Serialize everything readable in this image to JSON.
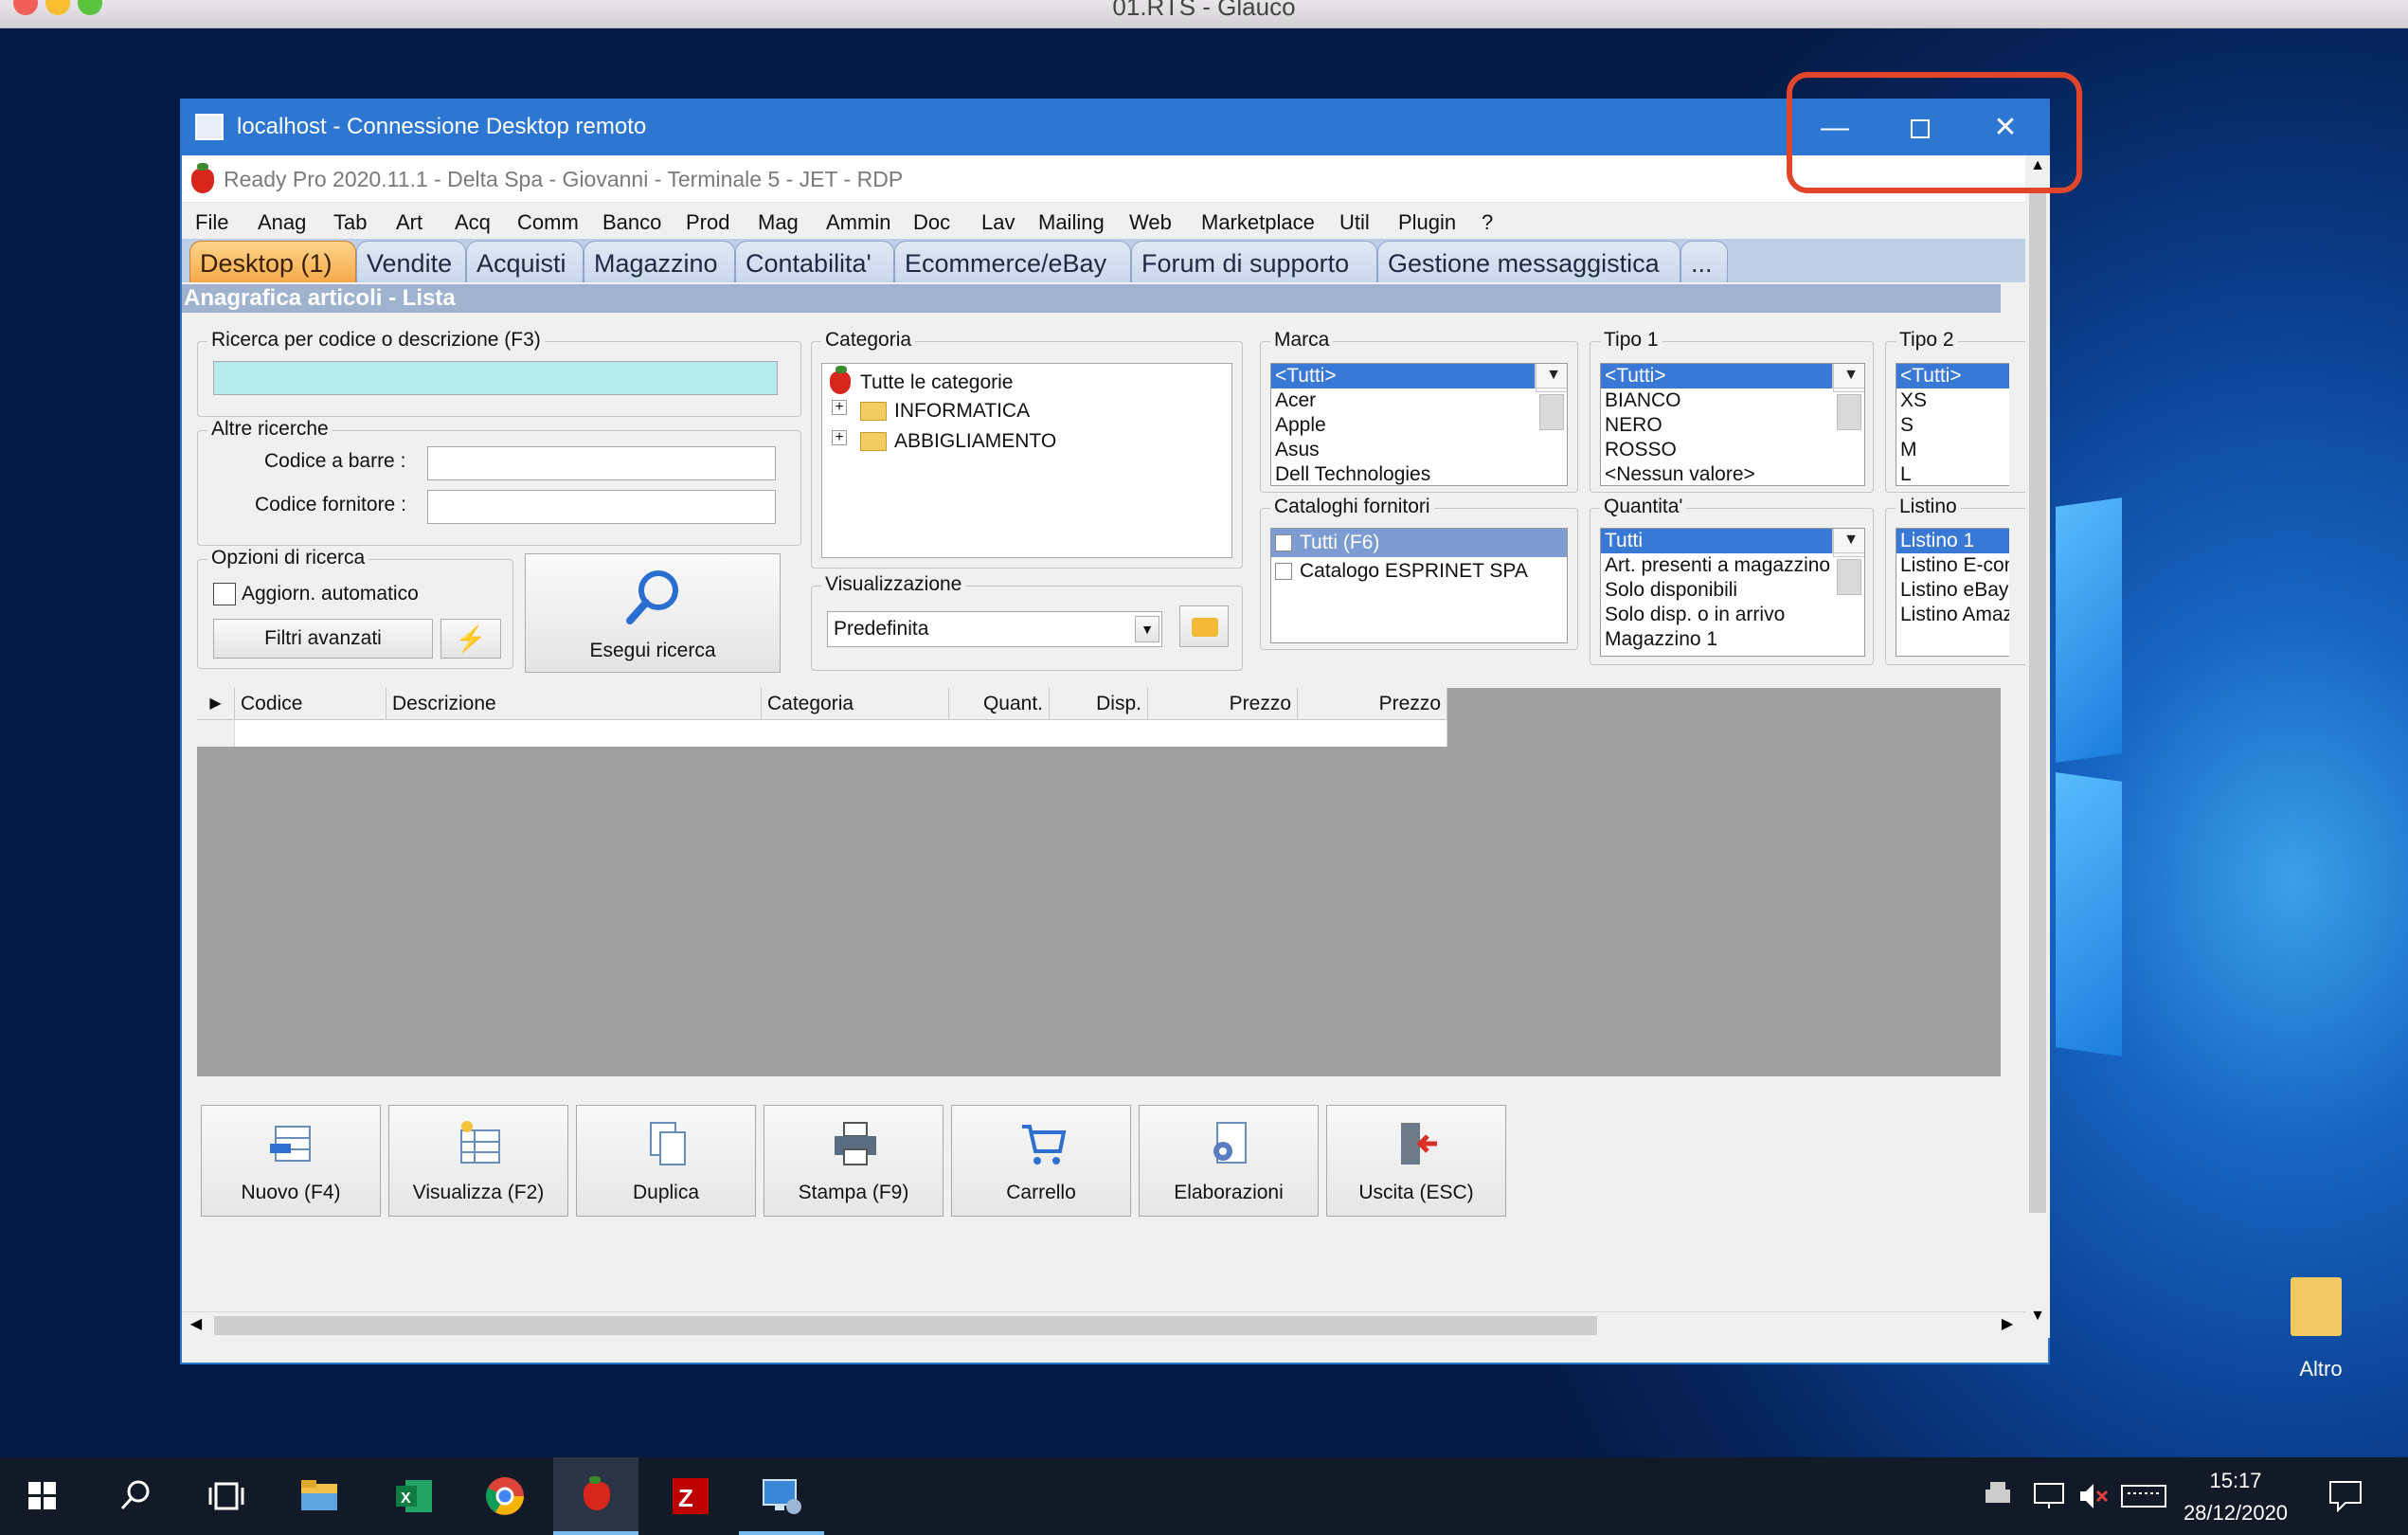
{
  "mac": {
    "title": "01.RTS - Glauco"
  },
  "rdp": {
    "title": "localhost - Connessione Desktop remoto"
  },
  "app": {
    "title": "Ready Pro 2020.11.1 - Delta Spa - Giovanni - Terminale 5 - JET - RDP",
    "menu": [
      "File",
      "Anag",
      "Tab",
      "Art",
      "Acq",
      "Comm",
      "Banco",
      "Prod",
      "Mag",
      "Ammin",
      "Doc",
      "Lav",
      "Mailing",
      "Web",
      "Marketplace",
      "Util",
      "Plugin",
      "?"
    ],
    "tabs": [
      "Desktop (1)",
      "Vendite",
      "Acquisti",
      "Magazzino",
      "Contabilita'",
      "Ecommerce/eBay",
      "Forum di supporto",
      "Gestione messaggistica",
      "..."
    ],
    "section_title": "Anagrafica articoli  - Lista",
    "search": {
      "group_label": "Ricerca per codice o descrizione (F3)",
      "other_label": "Altre ricerche",
      "barcode_label": "Codice a barre :",
      "supplier_code_label": "Codice fornitore :",
      "options_label": "Opzioni di ricerca",
      "auto_update_label": "Aggiorn. automatico",
      "advanced_filters": "Filtri avanzati",
      "execute": "Esegui ricerca"
    },
    "category": {
      "label": "Categoria",
      "items": [
        "Tutte le categorie",
        "INFORMATICA",
        "ABBIGLIAMENTO"
      ]
    },
    "view": {
      "label": "Visualizzazione",
      "selected": "Predefinita"
    },
    "marca": {
      "label": "Marca",
      "items": [
        "<Tutti>",
        "Acer",
        "Apple",
        "Asus",
        "Dell Technologies"
      ]
    },
    "tipo1": {
      "label": "Tipo 1",
      "items": [
        "<Tutti>",
        "BIANCO",
        "NERO",
        "ROSSO",
        "<Nessun valore>"
      ]
    },
    "tipo2": {
      "label": "Tipo 2",
      "items": [
        "<Tutti>",
        "XS",
        "S",
        "M",
        "L"
      ]
    },
    "cataloghi": {
      "label": "Cataloghi fornitori",
      "items": [
        "Tutti (F6)",
        "Catalogo ESPRINET SPA"
      ]
    },
    "quantita": {
      "label": "Quantita'",
      "items": [
        "Tutti",
        "Art. presenti a magazzino",
        "Solo disponibili",
        "Solo disp. o in arrivo",
        "Magazzino 1"
      ]
    },
    "listino": {
      "label": "Listino",
      "items": [
        "Listino 1",
        "Listino E-commerce",
        "Listino eBay",
        "Listino Amazon"
      ]
    },
    "grid_columns": [
      "Codice",
      "Descrizione",
      "Categoria",
      "Quant.",
      "Disp.",
      "Prezzo",
      "Prezzo"
    ],
    "buttons": [
      "Nuovo (F4)",
      "Visualizza (F2)",
      "Duplica",
      "Stampa (F9)",
      "Carrello",
      "Elaborazioni",
      "Uscita (ESC)"
    ]
  },
  "desktop": {
    "folder_label": "Altro"
  },
  "taskbar": {
    "time": "15:17",
    "date": "28/12/2020"
  }
}
